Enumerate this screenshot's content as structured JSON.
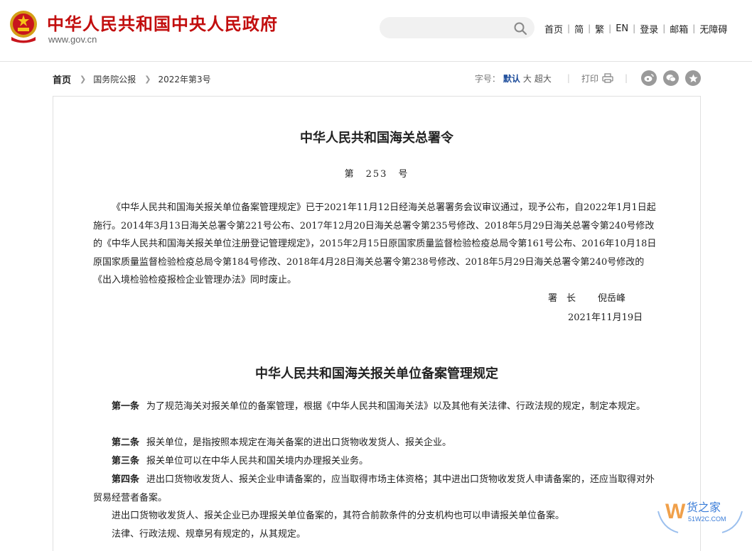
{
  "header": {
    "site_title": "中华人民共和国中央人民政府",
    "site_url": "www.gov.cn",
    "nav": [
      {
        "label": "首页"
      },
      {
        "label": "简"
      },
      {
        "label": "繁"
      },
      {
        "label": "EN"
      },
      {
        "label": "登录"
      },
      {
        "label": "邮箱"
      },
      {
        "label": "无障碍"
      }
    ],
    "search_placeholder": ""
  },
  "breadcrumb": {
    "home": "首页",
    "items": [
      "国务院公报",
      "2022年第3号"
    ]
  },
  "tools": {
    "font_size_label": "字号：",
    "sizes": [
      "默认",
      "大",
      "超大"
    ],
    "print_label": "打印"
  },
  "document": {
    "title": "中华人民共和国海关总署令",
    "number": "第　253　号",
    "intro": "《中华人民共和国海关报关单位备案管理规定》已于2021年11月12日经海关总署署务会议审议通过，现予公布，自2022年1月1日起施行。2014年3月13日海关总署令第221号公布、2017年12月20日海关总署令第235号修改、2018年5月29日海关总署令第240号修改的《中华人民共和国海关报关单位注册登记管理规定》，2015年2月15日原国家质量监督检验检疫总局令第161号公布、2016年10月18日原国家质量监督检验检疫总局令第184号修改、2018年4月28日海关总署令第238号修改、2018年5月29日海关总署令第240号修改的《出入境检验检疫报检企业管理办法》同时废止。",
    "signer_title": "署　长",
    "signer_name": "倪岳峰",
    "date": "2021年11月19日",
    "regulation_title": "中华人民共和国海关报关单位备案管理规定",
    "articles": [
      {
        "label": "第一条",
        "text": "为了规范海关对报关单位的备案管理，根据《中华人民共和国海关法》以及其他有关法律、行政法规的规定，制定本规定。"
      },
      {
        "label": "第二条",
        "text": "报关单位，是指按照本规定在海关备案的进出口货物收发货人、报关企业。"
      },
      {
        "label": "第三条",
        "text": "报关单位可以在中华人民共和国关境内办理报关业务。"
      },
      {
        "label": "第四条",
        "text": "进出口货物收发货人、报关企业申请备案的，应当取得市场主体资格；其中进出口货物收发货人申请备案的，还应当取得对外贸易经营者备案。"
      }
    ],
    "extra_paras": [
      "进出口货物收发货人、报关企业已办理报关单位备案的，其符合前款条件的分支机构也可以申请报关单位备案。",
      "法律、行政法规、规章另有规定的，从其规定。"
    ]
  },
  "watermark": {
    "text": "货之家",
    "url": "51W2C.COM",
    "color": "#3b7dd8"
  },
  "colors": {
    "brand_red": "#c20e0e",
    "link_blue": "#1b4b9a"
  }
}
